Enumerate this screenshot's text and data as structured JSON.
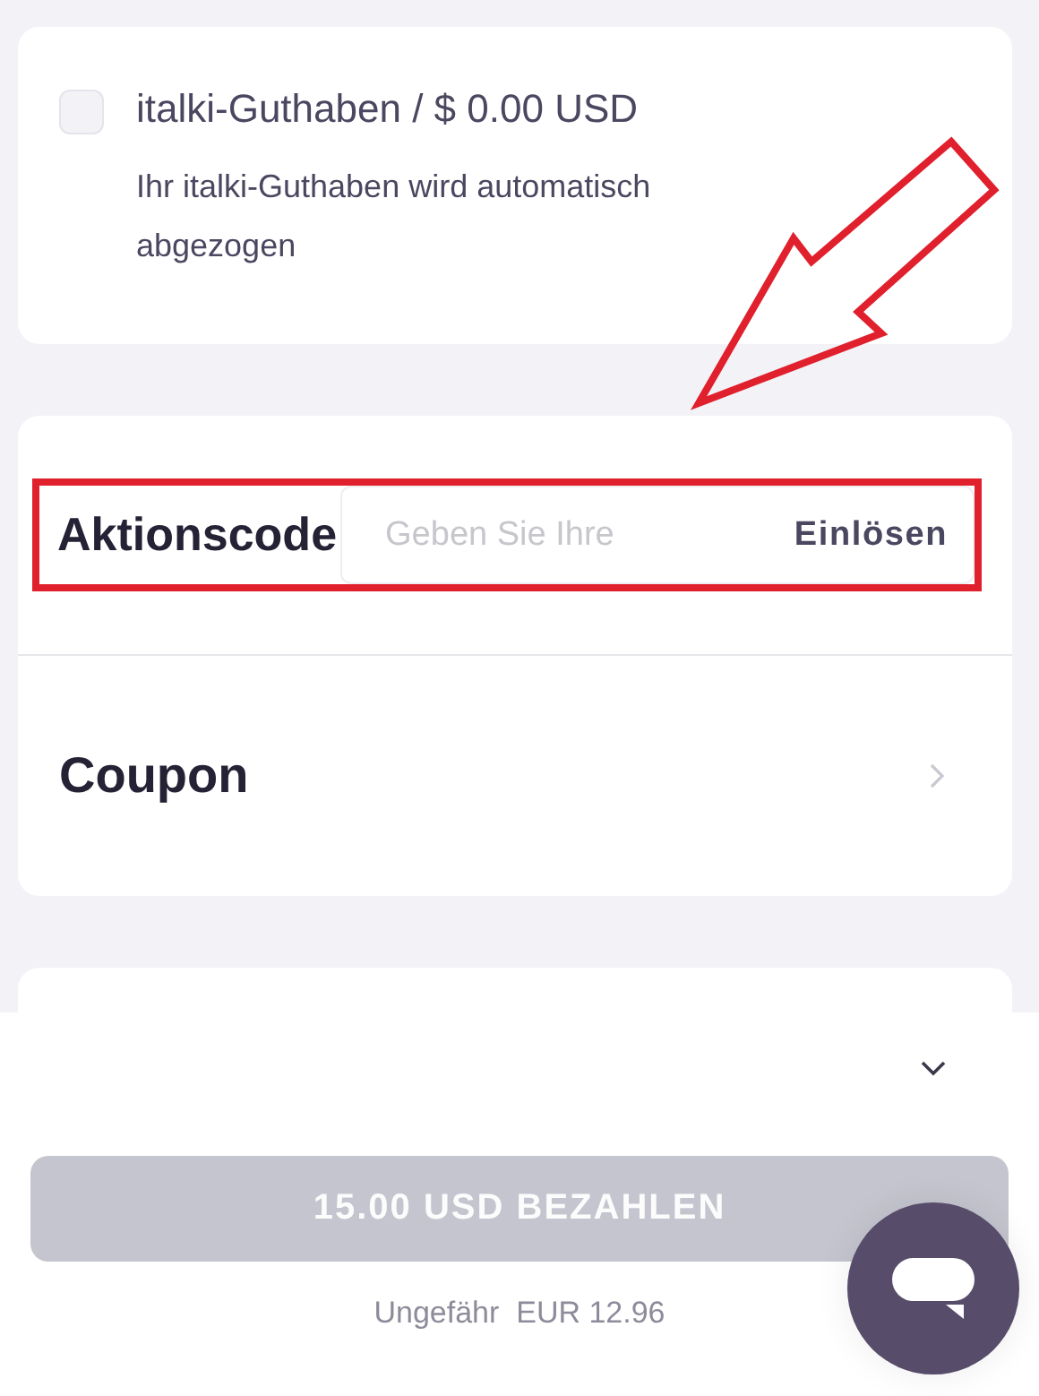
{
  "balance": {
    "checked": false,
    "label": "italki-Guthaben / $ 0.00 USD",
    "description": "Ihr italki-Guthaben wird automatisch abgezogen"
  },
  "promo_code": {
    "label": "Aktionscode",
    "placeholder": "Geben Sie Ihre",
    "button": "Einlösen"
  },
  "coupon": {
    "label": "Coupon"
  },
  "pay_button": {
    "label": "15.00 USD BEZAHLEN",
    "disabled": true
  },
  "approximate": {
    "label": "Ungefähr",
    "amount": "EUR 12.96"
  }
}
